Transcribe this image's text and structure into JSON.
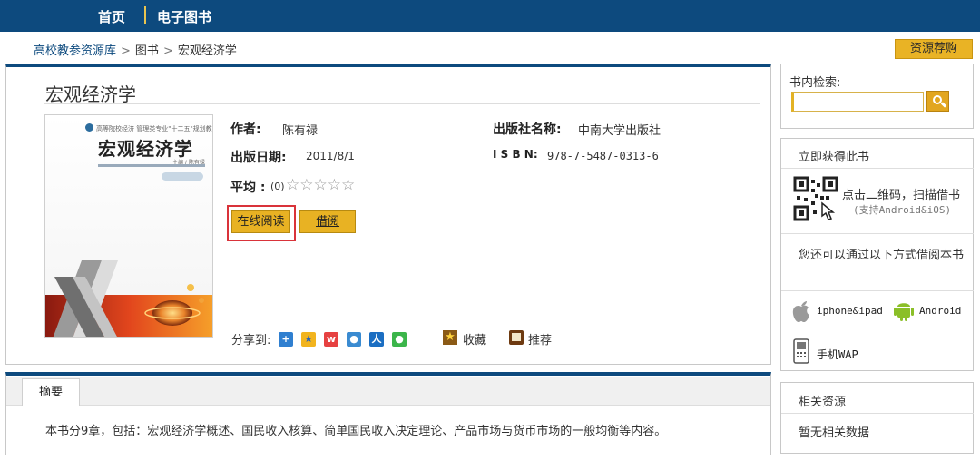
{
  "topnav": {
    "home": "首页",
    "ebook": "电子图书"
  },
  "breadcrumb": {
    "items": [
      "高校教参资源库",
      "图书",
      "宏观经济学"
    ],
    "separator": ">"
  },
  "recommend_button": "资源荐购",
  "book": {
    "title": "宏观经济学",
    "author_label": "作者:",
    "author": "陈有禄",
    "publisher_label": "出版社名称:",
    "publisher": "中南大学出版社",
    "date_label": "出版日期:",
    "date": "2011/8/1",
    "isbn_label": "I S B N:",
    "isbn": "978-7-5487-0313-6",
    "rating_label": "平均 :",
    "rating_count": "(0)",
    "rating_stars": "☆☆☆☆☆",
    "read_online": "在线阅读",
    "borrow": "借阅",
    "cover": {
      "top_line": "高等院校经济 管理类专业\"十二五\"规划教材",
      "title": "宏观经济学",
      "author": "主编 / 陈有禄"
    }
  },
  "share": {
    "label": "分享到:",
    "favorite": "收藏",
    "recommend": "推荐"
  },
  "tabs": {
    "summary": "摘要"
  },
  "summary": "本书分9章，包括：宏观经济学概述、国民收入核算、简单国民收入决定理论、产品市场与货币市场的一般均衡等内容。",
  "sidebar": {
    "search_label": "书内检索:",
    "get_book_title": "立即获得此书",
    "qr_text": "点击二维码，扫描借书",
    "qr_sub": "(支持Android&iOS)",
    "other_ways": "您还可以通过以下方式借阅本书",
    "iphone": "iphone&ipad",
    "android": "Android",
    "wap": "手机WAP",
    "related_title": "相关资源",
    "related_empty": "暂无相关数据"
  },
  "colors": {
    "nav_blue": "#0d4a7e",
    "accent_gold": "#e8b223",
    "highlight_red": "#d9333a"
  }
}
